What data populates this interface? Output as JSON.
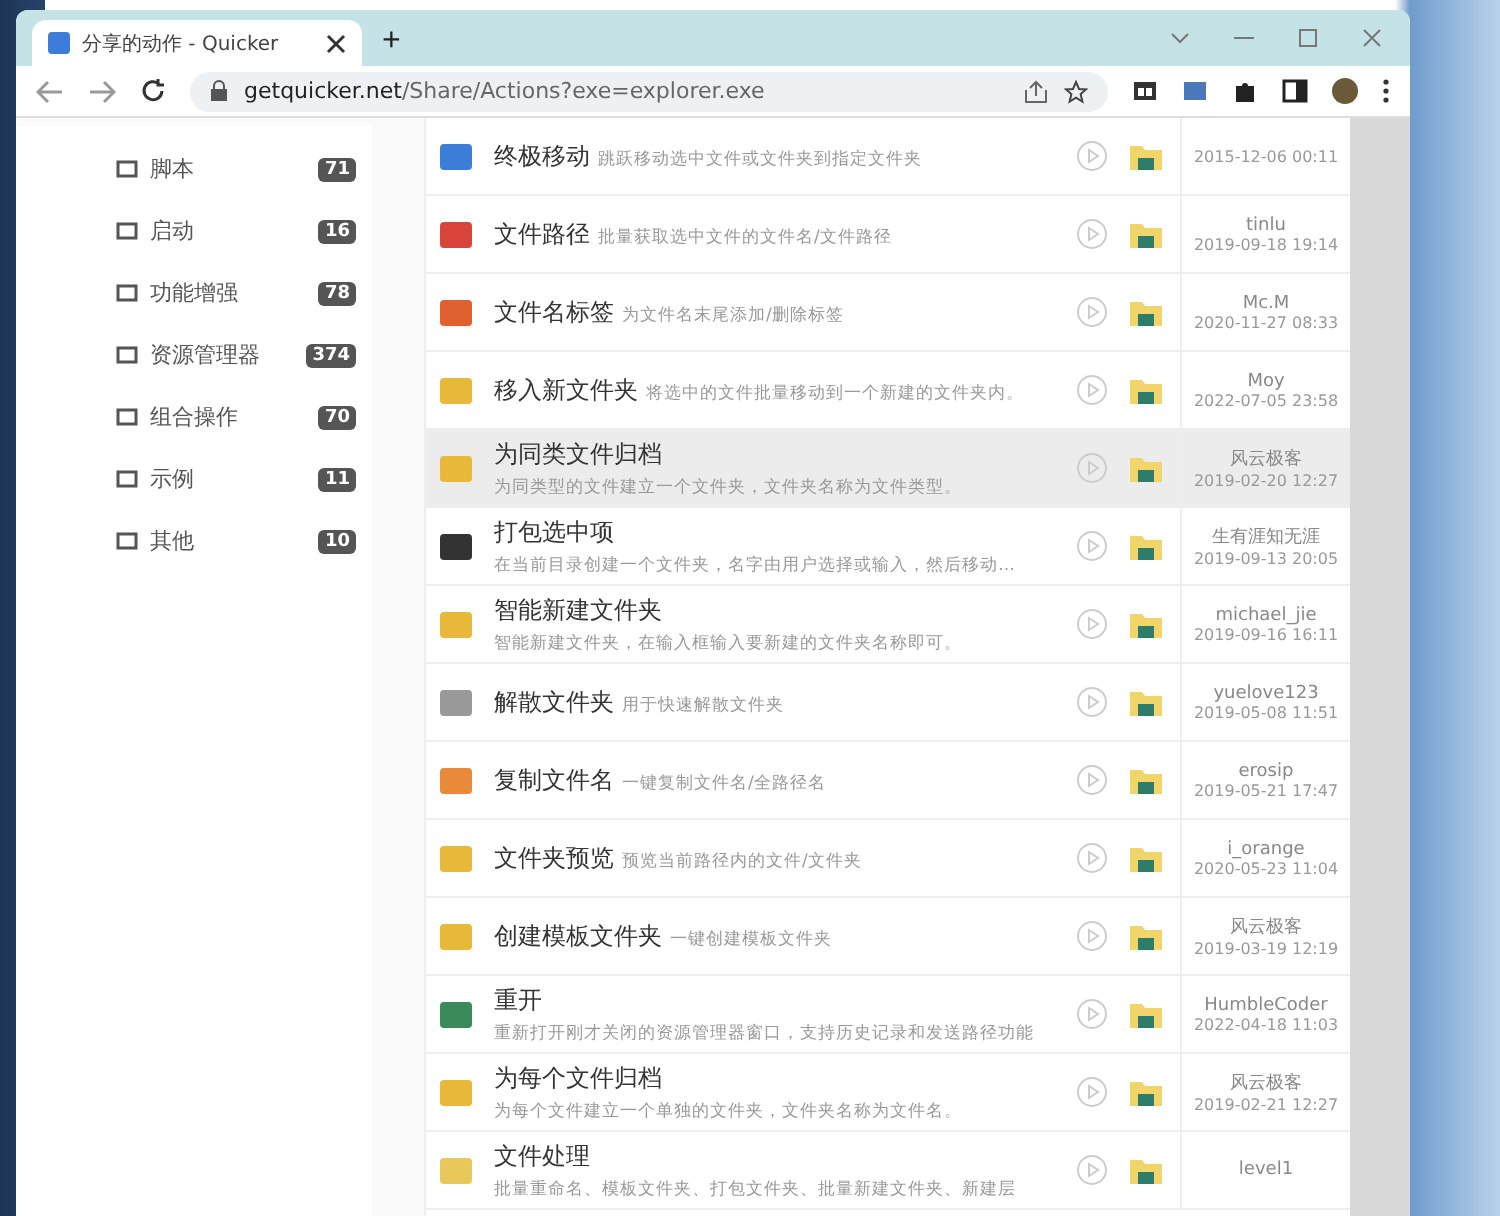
{
  "browser": {
    "tab_title": "分享的动作 - Quicker",
    "new_tab": "+",
    "url_host": "getquicker.net",
    "url_path": "/Share/Actions?exe=explorer.exe"
  },
  "sidebar": {
    "items": [
      {
        "label": "脚本",
        "count": "71",
        "selected": false
      },
      {
        "label": "启动",
        "count": "16",
        "selected": false
      },
      {
        "label": "功能增强",
        "count": "78",
        "selected": false
      },
      {
        "label": "资源管理器",
        "count": "374",
        "selected": false
      },
      {
        "label": "组合操作",
        "count": "70",
        "selected": false
      },
      {
        "label": "示例",
        "count": "11",
        "selected": false
      },
      {
        "label": "其他",
        "count": "10",
        "selected": false
      }
    ]
  },
  "actions": [
    {
      "kind": "inline",
      "title": "终极移动",
      "description": "跳跃移动选中文件或文件夹到指定文件夹",
      "date": "2015-12-06 00:11",
      "selected": false
    },
    {
      "kind": "inline",
      "title": "文件路径",
      "description": "批量获取选中文件的文件名/文件路径",
      "author": "tinlu",
      "date": "2019-09-18 19:14",
      "selected": false
    },
    {
      "kind": "inline",
      "title": "文件名标签",
      "description": "为文件名末尾添加/删除标签",
      "author": "Mc.M",
      "date": "2020-11-27 08:33",
      "selected": false
    },
    {
      "kind": "inline",
      "title": "移入新文件夹",
      "description": "将选中的文件批量移动到一个新建的文件夹内。",
      "author": "Moy",
      "date": "2022-07-05 23:58",
      "selected": false
    },
    {
      "kind": "stacked",
      "title": "为同类文件归档",
      "description": "为同类型的文件建立一个文件夹，文件夹名称为文件类型。",
      "author": "风云极客",
      "date": "2019-02-20 12:27",
      "selected": true
    },
    {
      "kind": "stacked",
      "title": "打包选中项",
      "description": "在当前目录创建一个文件夹，名字由用户选择或输入，然后移动…",
      "author": "生有涯知无涯",
      "date": "2019-09-13 20:05",
      "selected": false
    },
    {
      "kind": "stacked",
      "title": "智能新建文件夹",
      "description": "智能新建文件夹，在输入框输入要新建的文件夹名称即可。",
      "author": "michael_jie",
      "date": "2019-09-16 16:11",
      "selected": false
    },
    {
      "kind": "inline",
      "title": "解散文件夹",
      "description": "用于快速解散文件夹",
      "author": "yuelove123",
      "date": "2019-05-08 11:51",
      "selected": false
    },
    {
      "kind": "inline",
      "title": "复制文件名",
      "description": "一键复制文件名/全路径名",
      "author": "erosip",
      "date": "2019-05-21 17:47",
      "selected": false
    },
    {
      "kind": "inline",
      "title": "文件夹预览",
      "description": "预览当前路径内的文件/文件夹",
      "author": "i_orange",
      "date": "2020-05-23 11:04",
      "selected": false
    },
    {
      "kind": "inline",
      "title": "创建模板文件夹",
      "description": "一键创建模板文件夹",
      "author": "风云极客",
      "date": "2019-03-19 12:19",
      "selected": false
    },
    {
      "kind": "stacked",
      "title": "重开",
      "description": "重新打开刚才关闭的资源管理器窗口，支持历史记录和发送路径功能",
      "author": "HumbleCoder",
      "date": "2022-04-18 11:03",
      "selected": false
    },
    {
      "kind": "stacked",
      "title": "为每个文件归档",
      "description": "为每个文件建立一个单独的文件夹，文件夹名称为文件名。",
      "author": "风云极客",
      "date": "2019-02-21 12:27",
      "selected": false
    },
    {
      "kind": "stacked",
      "title": "文件处理",
      "description": "批量重命名、模板文件夹、打包文件夹、批量新建文件夹、新建层",
      "author": "level1",
      "selected": false
    }
  ]
}
